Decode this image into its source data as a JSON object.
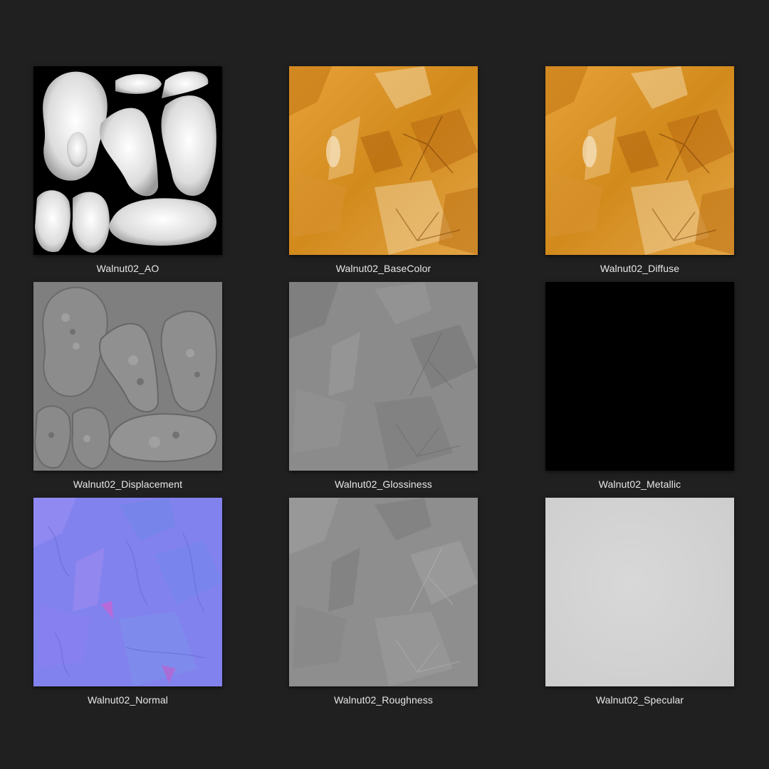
{
  "background_color": "#202020",
  "textures": [
    {
      "name": "Walnut02_AO",
      "preview": "ao-map-thumbnail",
      "tint": "#000000"
    },
    {
      "name": "Walnut02_BaseColor",
      "preview": "basecolor-map-thumbnail",
      "tint": "#d9911f"
    },
    {
      "name": "Walnut02_Diffuse",
      "preview": "diffuse-map-thumbnail",
      "tint": "#d9911f"
    },
    {
      "name": "Walnut02_Displacement",
      "preview": "displacement-map-thumbnail",
      "tint": "#808080"
    },
    {
      "name": "Walnut02_Glossiness",
      "preview": "glossiness-map-thumbnail",
      "tint": "#8a8a8a"
    },
    {
      "name": "Walnut02_Metallic",
      "preview": "metallic-map-thumbnail",
      "tint": "#000000"
    },
    {
      "name": "Walnut02_Normal",
      "preview": "normal-map-thumbnail",
      "tint": "#8080f0"
    },
    {
      "name": "Walnut02_Roughness",
      "preview": "roughness-map-thumbnail",
      "tint": "#8c8c8c"
    },
    {
      "name": "Walnut02_Specular",
      "preview": "specular-map-thumbnail",
      "tint": "#d4d4d4"
    }
  ]
}
